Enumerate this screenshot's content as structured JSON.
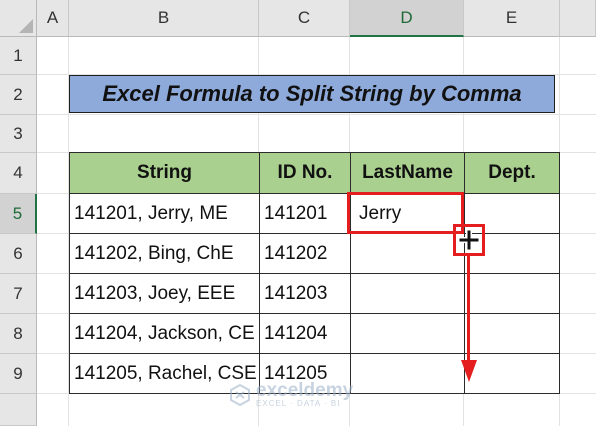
{
  "columns": [
    "A",
    "B",
    "C",
    "D",
    "E"
  ],
  "rows": [
    "1",
    "2",
    "3",
    "4",
    "5",
    "6",
    "7",
    "8",
    "9"
  ],
  "selected_column": "D",
  "selected_row": "5",
  "title": "Excel Formula to Split String by Comma",
  "table": {
    "headers": [
      "String",
      "ID No.",
      "LastName",
      "Dept."
    ],
    "rows": [
      [
        "141201, Jerry, ME",
        "141201",
        "Jerry",
        ""
      ],
      [
        "141202, Bing, ChE",
        "141202",
        "",
        ""
      ],
      [
        "141203, Joey, EEE",
        "141203",
        "",
        ""
      ],
      [
        "141204, Jackson, CE",
        "141204",
        "",
        ""
      ],
      [
        "141205, Rachel, CSE",
        "141205",
        "",
        ""
      ]
    ]
  },
  "watermark": {
    "name": "exceldemy",
    "tagline": "EXCEL · DATA · BI"
  },
  "colors": {
    "title_fill": "#8eaadb",
    "header_fill": "#a9d08e",
    "highlight": "#e41e1e",
    "selection": "#217346"
  },
  "icons": [
    "fill-handle-cursor-icon",
    "down-arrow-icon",
    "exceldemy-logo-icon"
  ]
}
